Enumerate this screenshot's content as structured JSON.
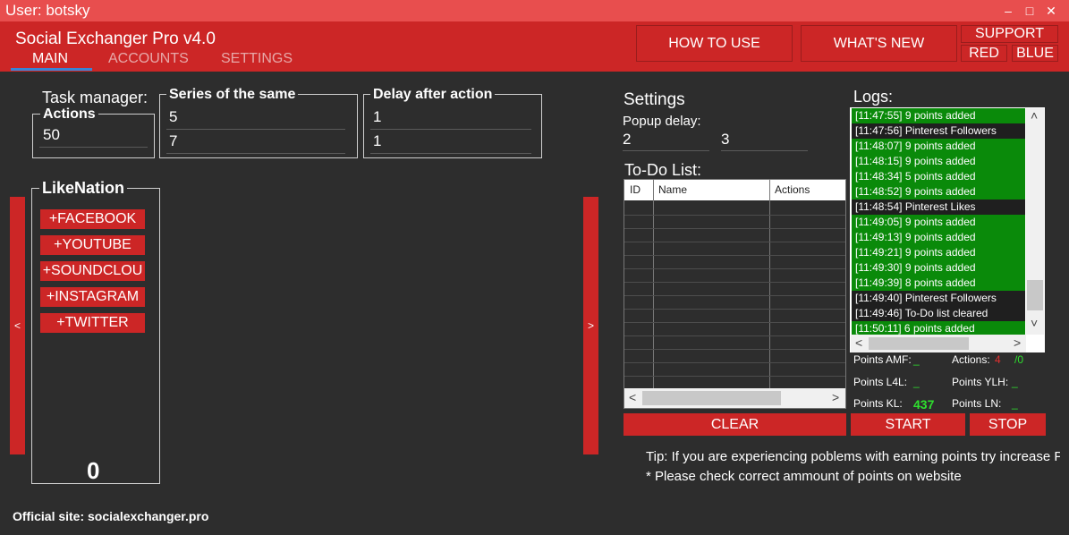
{
  "titlebar": {
    "user": "User: botsky",
    "minimize": "–",
    "maximize": "□",
    "close": "✕"
  },
  "header": {
    "app_title": "Social Exchanger Pro v4.0",
    "tabs": [
      {
        "label": "MAIN",
        "active": true
      },
      {
        "label": "ACCOUNTS",
        "active": false
      },
      {
        "label": "SETTINGS",
        "active": false
      }
    ],
    "how_to_use": "HOW TO USE",
    "whats_new": "WHAT'S NEW",
    "support": "SUPPORT",
    "red": "RED",
    "blue": "BLUE"
  },
  "task_manager": {
    "label": "Task manager:",
    "actions_legend": "Actions",
    "actions_value": "50",
    "series_legend": "Series of the same",
    "series_values": [
      "5",
      "7"
    ],
    "delay_legend": "Delay after action",
    "delay_values": [
      "1",
      "1"
    ]
  },
  "likenation": {
    "legend": "LikeNation",
    "buttons": [
      "+FACEBOOK",
      "+YOUTUBE",
      "+SOUNDCLOU",
      "+INSTAGRAM",
      "+TWITTER"
    ],
    "count": "0"
  },
  "nav": {
    "prev": "<",
    "next": ">"
  },
  "settings": {
    "label": "Settings",
    "popup_delay_label": "Popup delay:",
    "popup_values": [
      "2",
      "3"
    ]
  },
  "todo": {
    "label": "To-Do List:",
    "columns": [
      "ID",
      "Name",
      "Actions"
    ],
    "scroll_left": "<",
    "scroll_right": ">"
  },
  "buttons": {
    "clear": "CLEAR",
    "start": "START",
    "stop": "STOP"
  },
  "logs": {
    "label": "Logs:",
    "entries": [
      {
        "text": "[11:47:55] 9 points added",
        "kind": "green"
      },
      {
        "text": "[11:47:56] Pinterest Followers",
        "kind": "dark"
      },
      {
        "text": "[11:48:07] 9 points added",
        "kind": "green"
      },
      {
        "text": "[11:48:15] 9 points added",
        "kind": "green"
      },
      {
        "text": "[11:48:34] 5 points added",
        "kind": "green"
      },
      {
        "text": "[11:48:52] 9 points added",
        "kind": "green"
      },
      {
        "text": "[11:48:54] Pinterest Likes",
        "kind": "dark"
      },
      {
        "text": "[11:49:05] 9 points added",
        "kind": "green"
      },
      {
        "text": "[11:49:13] 9 points added",
        "kind": "green"
      },
      {
        "text": "[11:49:21] 9 points added",
        "kind": "green"
      },
      {
        "text": "[11:49:30] 9 points added",
        "kind": "green"
      },
      {
        "text": "[11:49:39] 8 points added",
        "kind": "green"
      },
      {
        "text": "[11:49:40] Pinterest Followers",
        "kind": "dark"
      },
      {
        "text": "[11:49:46] To-Do list cleared",
        "kind": "dark"
      },
      {
        "text": "[11:50:11] 6 points added",
        "kind": "green"
      }
    ],
    "scroll_up": "˄",
    "scroll_down": "˅",
    "scroll_left": "<",
    "scroll_right": ">"
  },
  "stats": {
    "points_amf_label": "Points AMF:",
    "points_amf": "_",
    "actions_label": "Actions:",
    "actions_done": "4",
    "actions_total": "/0",
    "points_l4l_label": "Points L4L:",
    "points_l4l": "_",
    "points_ylh_label": "Points YLH:",
    "points_ylh": "_",
    "points_kl_label": "Points KL:",
    "points_kl": "437",
    "points_ln_label": "Points LN:",
    "points_ln": "_"
  },
  "tips": {
    "tip": "Tip: If you are experiencing poblems with earning points try increase Pc",
    "note": "* Please check correct ammount of points on website"
  },
  "footer": {
    "official_site": "Official site: socialexchanger.pro"
  },
  "colors": {
    "accent": "#cc2626",
    "titlebar": "#e84e4e",
    "log_green": "#0a8a0a",
    "tab_underline": "#3a84d6"
  }
}
